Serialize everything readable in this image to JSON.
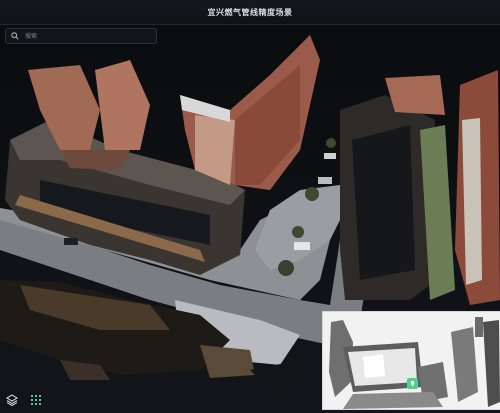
{
  "header": {
    "title": "宜兴燃气管线精度场景"
  },
  "search": {
    "placeholder": "搜索",
    "value": ""
  },
  "icons": {
    "search": "search-icon",
    "layers": "layers-icon",
    "grid": "grid-icon",
    "location": "location-pin-icon"
  },
  "colors": {
    "accent": "#4fd18b",
    "background": "#0b0d10",
    "header": "#15191e"
  }
}
